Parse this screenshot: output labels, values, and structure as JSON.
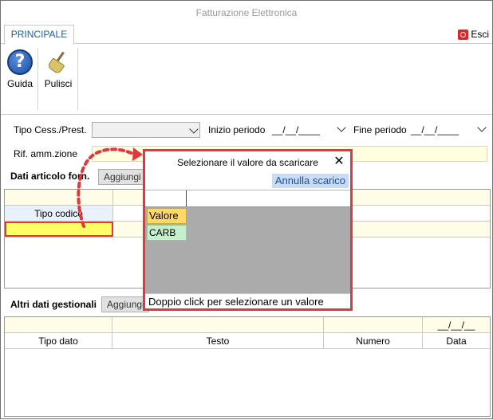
{
  "window": {
    "title": "Fatturazione Elettronica"
  },
  "ribbon": {
    "tab_principale": "PRINCIPALE",
    "esci": "Esci",
    "guida": "Guida",
    "pulisci": "Pulisci"
  },
  "form": {
    "tipo_cess_label": "Tipo Cess./Prest.",
    "inizio_label": "Inizio periodo",
    "inizio_value": "__/__/____",
    "fine_label": "Fine periodo",
    "fine_value": "__/__/____",
    "rif_label": "Rif. amm.zione"
  },
  "dati_articolo": {
    "title": "Dati articolo forn.",
    "aggiungi": "Aggiungi",
    "columns": [
      "Tipo codice",
      ""
    ]
  },
  "altri_dati": {
    "title": "Altri dati gestionali",
    "aggiungi": "Aggiungi",
    "date_placeholder": "__/__/__",
    "columns": [
      "Tipo dato",
      "Testo",
      "Numero",
      "Data"
    ]
  },
  "popup": {
    "title": "Selezionare il valore da scaricare",
    "close": "✕",
    "annulla": "Annulla scarico",
    "items": [
      "Valore",
      "CARB"
    ],
    "footer": "Doppio click per selezionare un valore"
  },
  "colors": {
    "accent_red": "#e0383d",
    "field_yellow": "#ffffe0",
    "header_yellow": "#fffde7"
  }
}
